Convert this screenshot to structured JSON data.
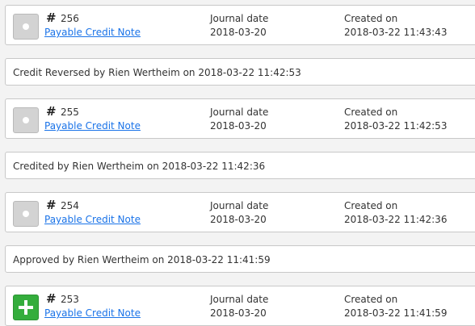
{
  "entries": [
    {
      "number": "256",
      "type": "Payable Credit Note",
      "status_icon": "circle-icon",
      "journal_label": "Journal date",
      "journal_date": "2018-03-20",
      "created_label": "Created on",
      "created_on": "2018-03-22 11:43:43"
    },
    {
      "number": "255",
      "type": "Payable Credit Note",
      "status_icon": "circle-icon",
      "journal_label": "Journal date",
      "journal_date": "2018-03-20",
      "created_label": "Created on",
      "created_on": "2018-03-22 11:42:53"
    },
    {
      "number": "254",
      "type": "Payable Credit Note",
      "status_icon": "circle-icon",
      "journal_label": "Journal date",
      "journal_date": "2018-03-20",
      "created_label": "Created on",
      "created_on": "2018-03-22 11:42:36"
    },
    {
      "number": "253",
      "type": "Payable Credit Note",
      "status_icon": "plus-icon",
      "journal_label": "Journal date",
      "journal_date": "2018-03-20",
      "created_label": "Created on",
      "created_on": "2018-03-22 11:41:59"
    }
  ],
  "events": [
    "Credit Reversed by Rien Wertheim on 2018-03-22 11:42:53",
    "Credited by Rien Wertheim on 2018-03-22 11:42:36",
    "Approved by Rien Wertheim on 2018-03-22 11:41:59"
  ],
  "hash_symbol": "#",
  "colors": {
    "link": "#1a73e8",
    "approved": "#34ad3c",
    "pending": "#d3d3d3",
    "border": "#c8c8c8",
    "background": "#f3f3f3"
  }
}
